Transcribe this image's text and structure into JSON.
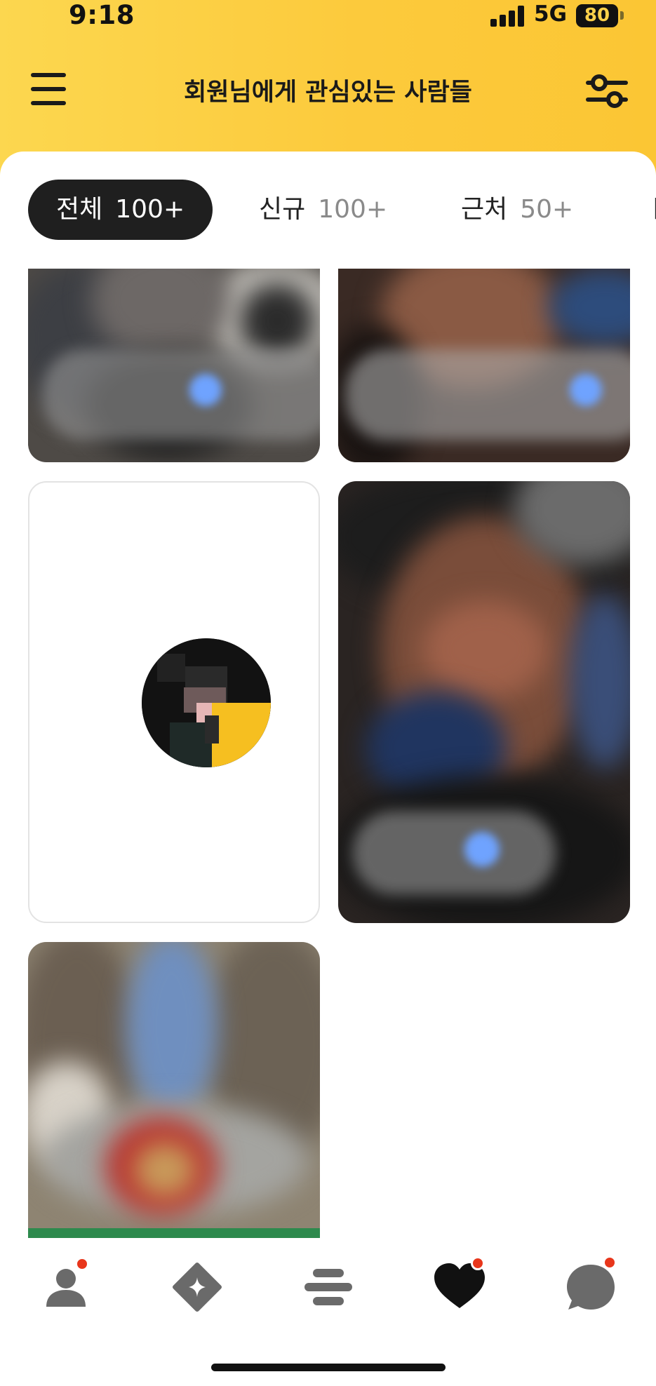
{
  "status_bar": {
    "time": "9:18",
    "network": "5G",
    "battery": "80"
  },
  "header": {
    "title": "회원님에게 관심있는 사람들",
    "menu_icon": "hamburger-menu-icon",
    "filter_icon": "filter-sliders-icon"
  },
  "tabs": [
    {
      "label": "전체",
      "count": "100+",
      "active": true
    },
    {
      "label": "신규",
      "count": "100+",
      "active": false
    },
    {
      "label": "근처",
      "count": "50+",
      "active": false
    }
  ],
  "cards": [
    {
      "type": "photo",
      "blurred": true
    },
    {
      "type": "photo",
      "blurred": true
    },
    {
      "type": "placeholder-avatar",
      "blurred": true
    },
    {
      "type": "photo",
      "blurred": true
    },
    {
      "type": "photo",
      "blurred": true
    }
  ],
  "bottom_nav": {
    "items": [
      {
        "icon": "profile-icon",
        "badge": true
      },
      {
        "icon": "diamond-sparkle-icon",
        "badge": false
      },
      {
        "icon": "feed-lines-icon",
        "badge": false
      },
      {
        "icon": "heart-icon",
        "badge": true,
        "active": true
      },
      {
        "icon": "chat-bubble-icon",
        "badge": true
      }
    ]
  },
  "colors": {
    "header_yellow": "#fcd14a",
    "active_tab_bg": "#1f1f1f",
    "badge_red": "#e8361b",
    "verified_blue": "#6fa3ff"
  }
}
